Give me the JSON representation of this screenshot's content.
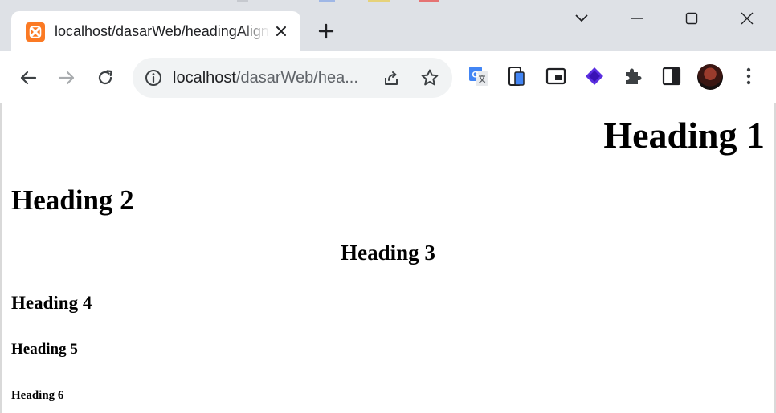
{
  "browser": {
    "tab": {
      "title": "localhost/dasarWeb/headingAlign.html",
      "favicon": "xampp-icon"
    },
    "address_bar": {
      "host": "localhost",
      "path": "/dasarWeb/hea..."
    },
    "accent_color": "#fb7a24"
  },
  "page": {
    "h1": "Heading 1",
    "h2": "Heading 2",
    "h3": "Heading 3",
    "h4": "Heading 4",
    "h5": "Heading 5",
    "h6": "Heading 6"
  }
}
